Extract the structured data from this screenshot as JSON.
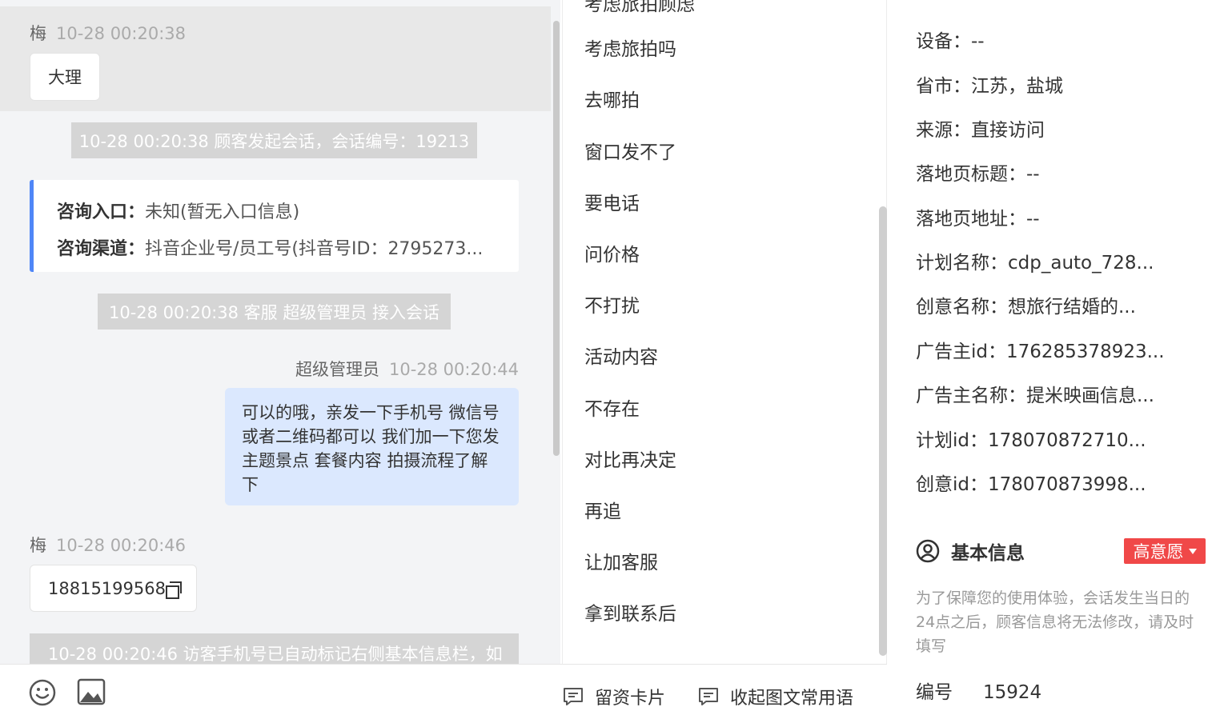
{
  "chat": {
    "msg1": {
      "sender": "梅",
      "time": "10-28 00:20:38",
      "text": "大理"
    },
    "sys1": "10-28 00:20:38 顾客发起会话，会话编号：19213",
    "consult": {
      "entry_label": "咨询入口：",
      "entry_value": "未知(暂无入口信息)",
      "channel_label": "咨询渠道：",
      "channel_value": "抖音企业号/员工号(抖音号ID：2795273..."
    },
    "sys2": "10-28 00:20:38 客服 超级管理员 接入会话",
    "agent": {
      "name": "超级管理员",
      "time": "10-28 00:20:44",
      "text": "可以的哦，亲发一下手机号 微信号或者二维码都可以 我们加一下您发主题景点 套餐内容 拍摄流程了解下"
    },
    "msg2": {
      "sender": "梅",
      "time": "10-28 00:20:46",
      "text": "18815199568"
    },
    "sys3": "10-28 00:20:46 访客手机号已自动标记右侧基本信息栏，如"
  },
  "toolbar": {
    "emoji_icon": "smiley-icon",
    "image_icon": "image-icon",
    "card_label": "留资卡片",
    "collapse_label": "收起图文常用语"
  },
  "phrases": {
    "partial_top": "考虑旅拍顾虑",
    "items": [
      "考虑旅拍吗",
      "去哪拍",
      "窗口发不了",
      "要电话",
      "问价格",
      "不打扰",
      "活动内容",
      "不存在",
      "对比再决定",
      "再追",
      "让加客服",
      "拿到联系后"
    ]
  },
  "info": {
    "rows": [
      {
        "label": "设备：",
        "value": "--"
      },
      {
        "label": "省市：",
        "value": "江苏，盐城"
      },
      {
        "label": "来源：",
        "value": "直接访问"
      },
      {
        "label": "落地页标题：",
        "value": "--"
      },
      {
        "label": "落地页地址：",
        "value": "--"
      },
      {
        "label": "计划名称：",
        "value": "cdp_auto_728..."
      },
      {
        "label": "创意名称：",
        "value": "想旅行结婚的..."
      },
      {
        "label": "广告主id：",
        "value": "176285378923..."
      },
      {
        "label": "广告主名称：",
        "value": "提米映画信息..."
      },
      {
        "label": "计划id：",
        "value": "178070872710..."
      },
      {
        "label": "创意id：",
        "value": "178070873998..."
      }
    ],
    "section_title": "基本信息",
    "section_icon": "user-circle-icon",
    "intent_tag": "高意愿",
    "intent_color": "#f04848",
    "notice": "为了保障您的使用体验，会话发生当日的24点之后，顾客信息将无法修改，请及时填写",
    "id_label": "编号",
    "id_value": "15924"
  },
  "colors": {
    "accent": "#4f86f7",
    "agent_bubble": "#dbe8fe",
    "system_bar": "#d5d5d5"
  }
}
